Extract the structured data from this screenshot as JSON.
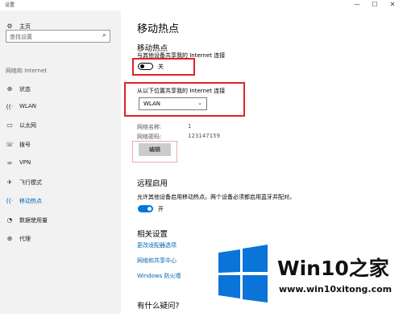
{
  "window": {
    "title": "设置",
    "minimize": "—",
    "maximize": "☐",
    "close": "✕"
  },
  "sidebar": {
    "home": "主页",
    "search_placeholder": "查找设置",
    "section": "网络和 Internet",
    "items": [
      {
        "label": "状态",
        "icon": "status-icon",
        "glyph": "⊕"
      },
      {
        "label": "WLAN",
        "icon": "wifi-icon",
        "glyph": "((·"
      },
      {
        "label": "以太网",
        "icon": "ethernet-icon",
        "glyph": "▭"
      },
      {
        "label": "拨号",
        "icon": "dialup-icon",
        "glyph": "☏"
      },
      {
        "label": "VPN",
        "icon": "vpn-icon",
        "glyph": "∞"
      },
      {
        "label": "飞行模式",
        "icon": "airplane-icon",
        "glyph": "✈"
      },
      {
        "label": "移动热点",
        "icon": "hotspot-icon",
        "glyph": "((·"
      },
      {
        "label": "数据使用量",
        "icon": "data-usage-icon",
        "glyph": "◔"
      },
      {
        "label": "代理",
        "icon": "proxy-icon",
        "glyph": "⊕"
      }
    ],
    "active_index": 6
  },
  "main": {
    "title": "移动热点",
    "hotspot": {
      "heading": "移动热点",
      "desc": "与其他设备共享我的 Internet 连接",
      "toggle_state": "关"
    },
    "share_from": {
      "label": "从以下位置共享我的 Internet 连接",
      "value": "WLAN"
    },
    "network_name_label": "网络名称:",
    "network_name_value": "1",
    "network_password_label": "网络密码:",
    "network_password_value": "123147159",
    "edit_button": "编辑",
    "remote": {
      "heading": "远程启用",
      "desc": "允许其他设备启用移动热点。两个设备必须都启用蓝牙并配对。",
      "toggle_state": "开"
    },
    "related": {
      "heading": "相关设置",
      "links": [
        "更改适配器选项",
        "网络和共享中心",
        "Windows 防火墙"
      ]
    },
    "question": "有什么疑问?"
  },
  "watermark": {
    "brand": "Win10之家",
    "url": "www.win10xitong.com"
  },
  "colors": {
    "accent": "#0078d7",
    "highlight_box": "#e0232b",
    "link": "#0063b1"
  }
}
